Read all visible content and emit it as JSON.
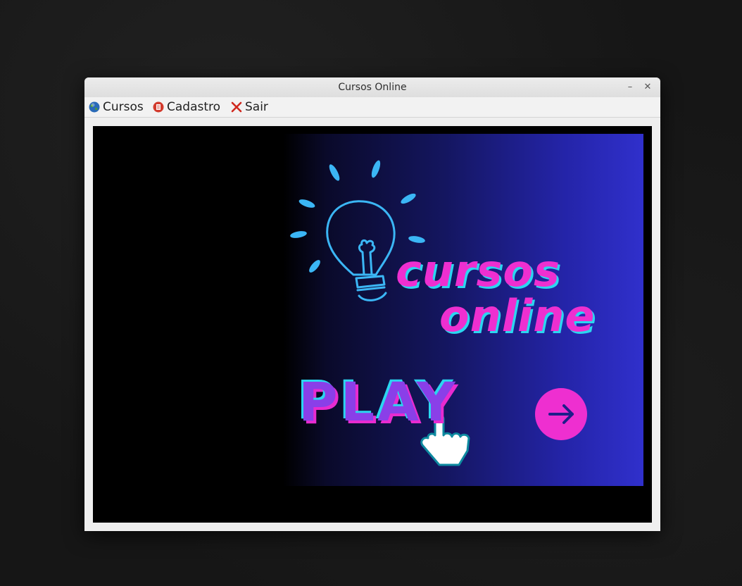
{
  "window": {
    "title": "Cursos Online",
    "minimize_symbol": "–",
    "close_symbol": "✕"
  },
  "menu": {
    "items": [
      {
        "label": "Cursos",
        "icon": "globe-icon"
      },
      {
        "label": "Cadastro",
        "icon": "red-form-icon"
      },
      {
        "label": "Sair",
        "icon": "red-x-icon"
      }
    ]
  },
  "banner": {
    "brand_line1": "cursos",
    "brand_line2": "online",
    "play_label": "PLAY",
    "icons": [
      "lightbulb-icon",
      "pointer-hand-icon",
      "arrow-right-icon"
    ],
    "colors": {
      "pink": "#ee2fd0",
      "cyan": "#2bd6f0",
      "purple": "#8a3fe8",
      "blue_dark": "#0a0a2a",
      "blue_light": "#3030cc"
    }
  }
}
